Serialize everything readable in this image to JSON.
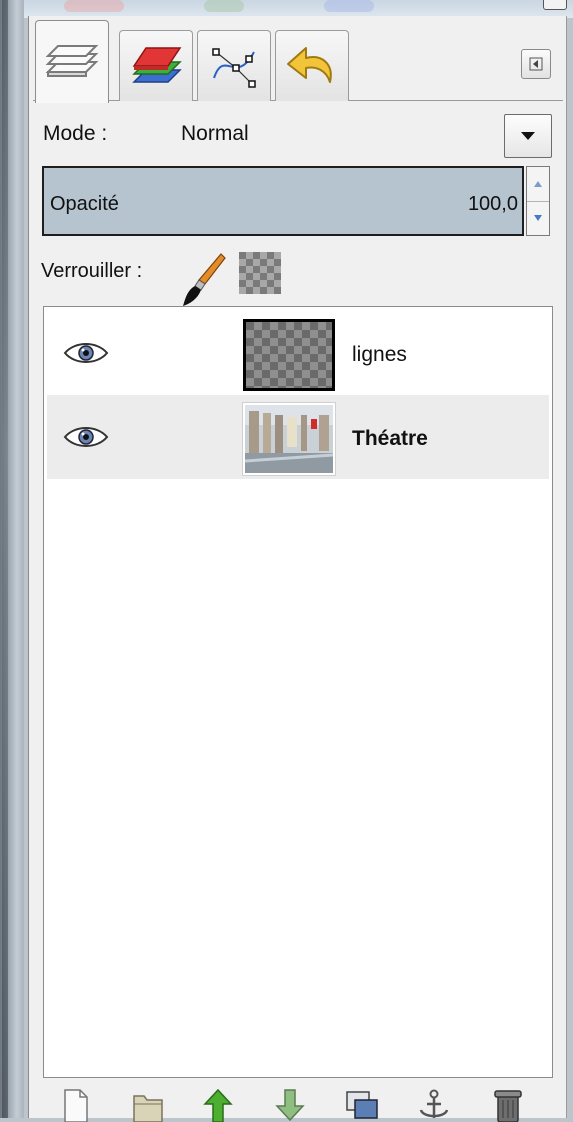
{
  "tabs": [
    {
      "name": "layers",
      "icon": "layers-icon",
      "active": true
    },
    {
      "name": "channels",
      "icon": "channels-icon",
      "active": false
    },
    {
      "name": "paths",
      "icon": "paths-icon",
      "active": false
    },
    {
      "name": "undo-history",
      "icon": "undo-icon",
      "active": false
    }
  ],
  "mode": {
    "label": "Mode :",
    "value": "Normal"
  },
  "opacity": {
    "label": "Opacité",
    "value": "100,0"
  },
  "lock": {
    "label": "Verrouiller :"
  },
  "layers": [
    {
      "name": "lignes",
      "visible": true,
      "thumbnail": "transparent-checker",
      "active": false
    },
    {
      "name": "Théatre",
      "visible": true,
      "thumbnail": "photo",
      "active": true
    }
  ],
  "toolbar": [
    "new-layer-icon",
    "new-group-icon",
    "raise-layer-icon",
    "lower-layer-icon",
    "duplicate-layer-icon",
    "anchor-layer-icon",
    "delete-layer-icon"
  ],
  "colors": {
    "opacity_bar": "#b6c4cf",
    "active_row": "#ececec",
    "accent_green": "#4caf2f"
  }
}
